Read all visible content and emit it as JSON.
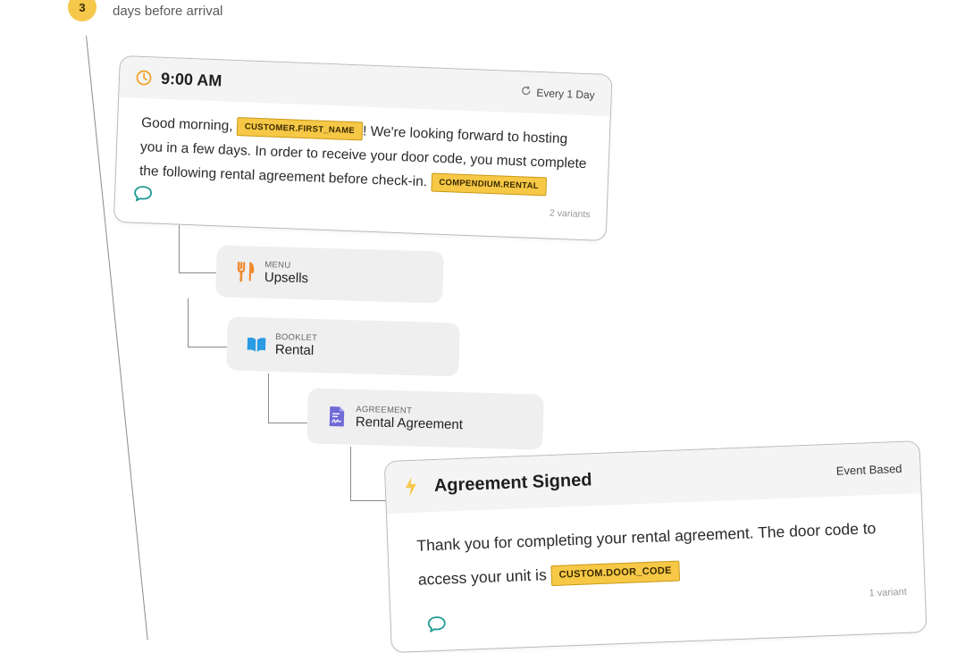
{
  "step": {
    "number": "3",
    "label": "days before arrival"
  },
  "scheduled_message": {
    "time": "9:00 AM",
    "repeat": "Every 1 Day",
    "text_before_tag1": "Good morning, ",
    "tag1": "CUSTOMER.FIRST_NAME",
    "text_after_tag1": "! We're looking forward to hosting you in a few days. In order to receive your door code, you must complete the following rental agreement before check-in. ",
    "tag2": "COMPENDIUM.RENTAL",
    "variants": "2 variants"
  },
  "nodes": {
    "menu": {
      "kind": "MENU",
      "title": "Upsells"
    },
    "booklet": {
      "kind": "BOOKLET",
      "title": "Rental"
    },
    "agreement": {
      "kind": "AGREEMENT",
      "title": "Rental Agreement"
    }
  },
  "event_message": {
    "title": "Agreement Signed",
    "type": "Event Based",
    "text_before_tag": "Thank you for completing your rental agreement. The door code to access your unit is ",
    "tag": "CUSTOM.DOOR_CODE",
    "variants": "1 variant"
  },
  "colors": {
    "accent_yellow": "#f5c84c",
    "tag_fill": "#f6c846",
    "chat_icon": "#1e9a91",
    "clock_icon": "#f2a531",
    "menu_icon": "#f08a2e",
    "booklet_icon": "#2b9be3",
    "agreement_icon": "#6f6ad6"
  }
}
